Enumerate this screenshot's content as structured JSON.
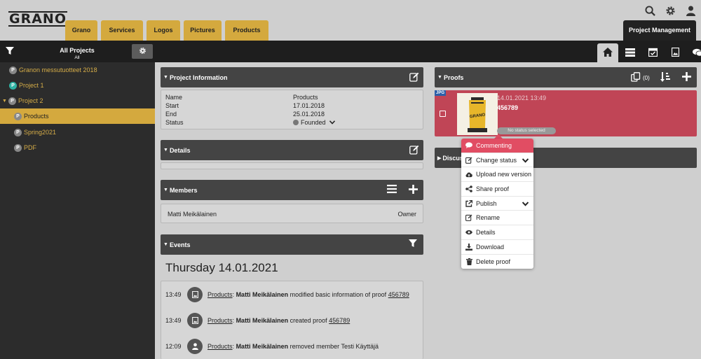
{
  "app": {
    "logo": "GRANO",
    "top_tabs": [
      "Grano",
      "Services",
      "Logos",
      "Pictures",
      "Products"
    ],
    "right_tab": "Project Management",
    "tool_icons": [
      "search-icon",
      "gear-icon",
      "user-icon"
    ]
  },
  "projects_header": {
    "title": "All Projects",
    "subtitle": "All"
  },
  "view_tabs": [
    "home-icon",
    "server-icon",
    "calendar-check-icon",
    "image-icon",
    "comments-icon"
  ],
  "sidebar": {
    "items": [
      {
        "label": "Granon messutuotteet 2018",
        "badge": "P"
      },
      {
        "label": "Project 1",
        "badge": "P"
      },
      {
        "label": "Project 2",
        "badge": "P"
      },
      {
        "label": "Products",
        "badge": "P"
      },
      {
        "label": "Spring2021",
        "badge": "P"
      },
      {
        "label": "PDF",
        "badge": "P"
      }
    ]
  },
  "project_info": {
    "title": "Project Information",
    "rows": [
      {
        "label": "Name",
        "value": "Products"
      },
      {
        "label": "Start",
        "value": "17.01.2018"
      },
      {
        "label": "End",
        "value": "25.01.2018"
      },
      {
        "label": "Status",
        "value": "Founded"
      }
    ]
  },
  "details": {
    "title": "Details"
  },
  "members": {
    "title": "Members",
    "list": [
      {
        "name": "Matti Meikälainen",
        "role": "Owner"
      }
    ]
  },
  "events": {
    "title": "Events",
    "date": "Thursday 14.01.2021",
    "items": [
      {
        "time": "13:49",
        "project": "Products",
        "sep": ":",
        "user": "Matti Meikälainen",
        "text": "modified basic information of proof",
        "ref": "456789"
      },
      {
        "time": "13:49",
        "project": "Products",
        "sep": ":",
        "user": "Matti Meikälainen",
        "text": "created proof",
        "ref": "456789"
      },
      {
        "time": "12:09",
        "project": "Products",
        "sep": ":",
        "user": "Matti Meikälainen",
        "text": "removed member Testi Käyttäjä",
        "ref": ""
      }
    ]
  },
  "proofs": {
    "title": "Proofs",
    "count": "(0)",
    "card": {
      "badge": "JPG",
      "date": "14.01.2021 13:49",
      "name": "456789",
      "status": "No status selected",
      "thumb_text": "GRANO"
    }
  },
  "discussion": {
    "title": "Discus"
  },
  "context_menu": {
    "items": [
      {
        "label": "Commenting",
        "icon": "comment-icon"
      },
      {
        "label": "Change status",
        "icon": "edit-icon"
      },
      {
        "label": "Upload new version",
        "icon": "cloud-upload-icon"
      },
      {
        "label": "Share proof",
        "icon": "share-icon"
      },
      {
        "label": "Publish",
        "icon": "external-link-icon"
      },
      {
        "label": "Rename",
        "icon": "edit-icon"
      },
      {
        "label": "Details",
        "icon": "eye-icon"
      },
      {
        "label": "Download",
        "icon": "download-icon"
      },
      {
        "label": "Delete proof",
        "icon": "trash-icon"
      }
    ]
  },
  "colors": {
    "accent": "#d4a93e",
    "proof_card": "#c04556",
    "menu_highlight": "#e14d63",
    "panel_header": "#444444",
    "sidebar": "#2c2c2c"
  }
}
